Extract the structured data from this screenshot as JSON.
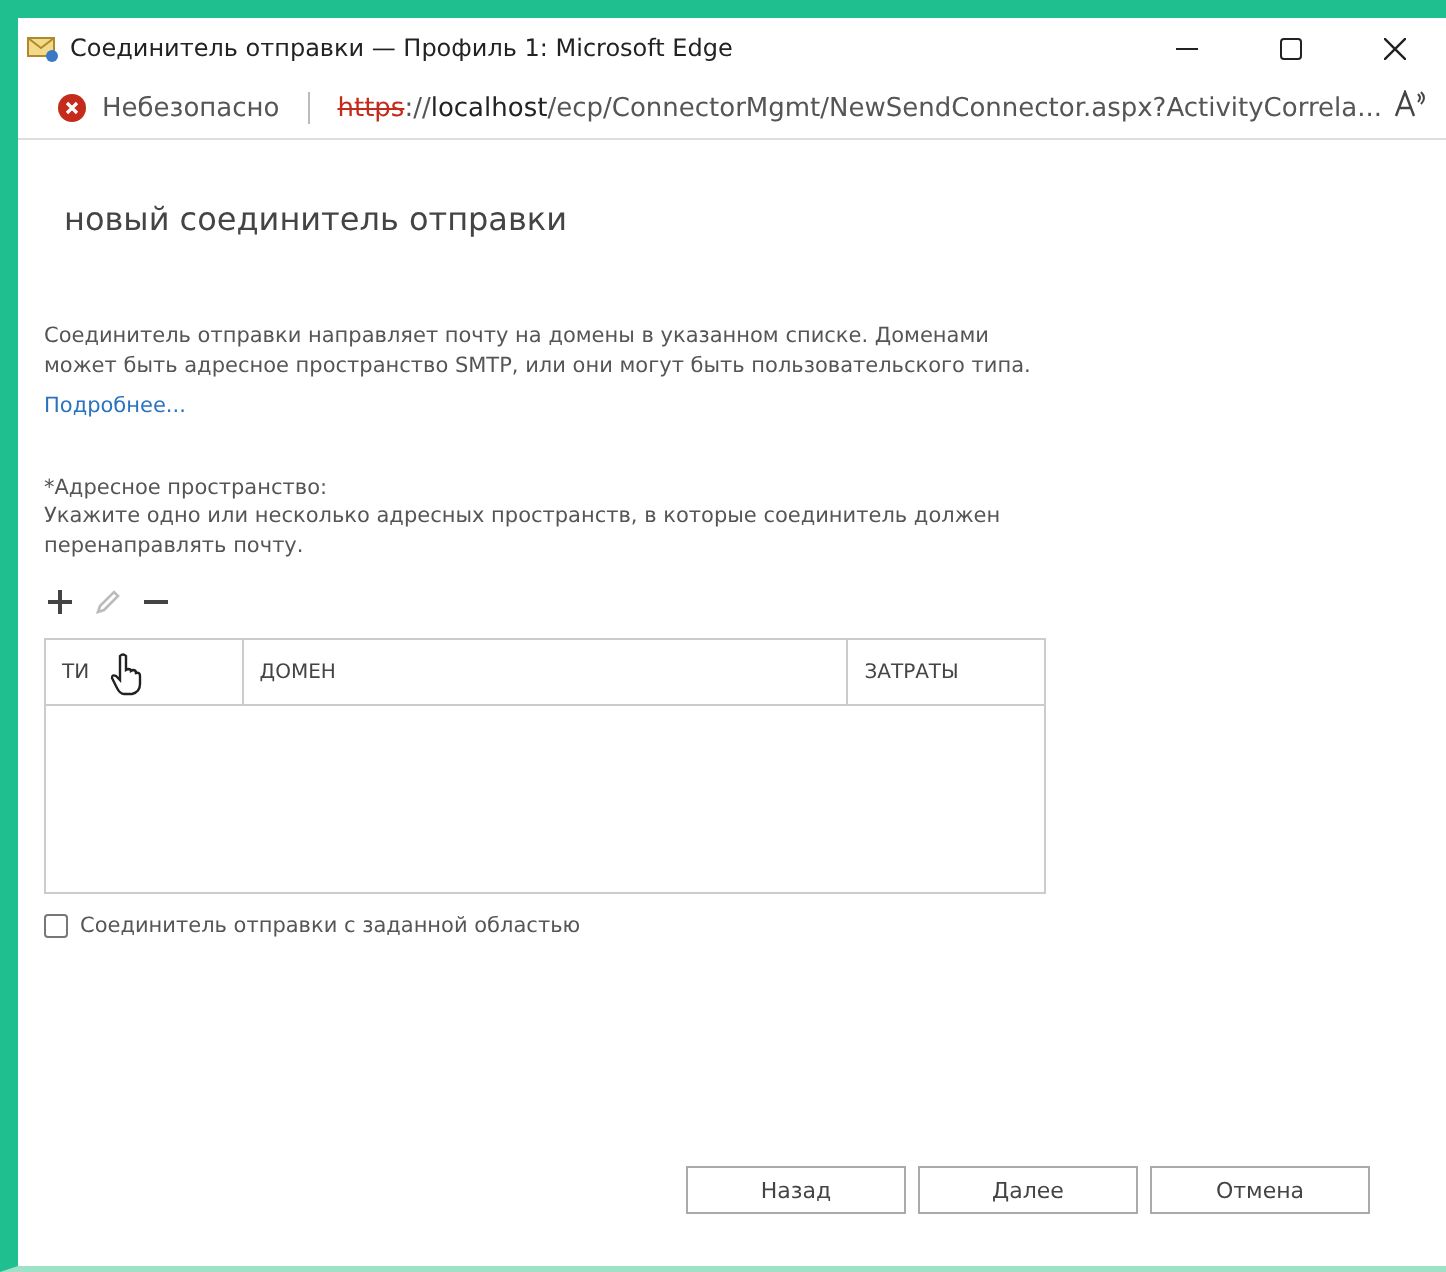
{
  "window": {
    "title": "Соединитель отправки — Профиль 1: Microsoft Edge"
  },
  "address_bar": {
    "security": "Небезопасно",
    "scheme": "https",
    "url_rest": "://",
    "host": "localhost",
    "path": "/ecp/ConnectorMgmt/NewSendConnector.aspx?ActivityCorrela..."
  },
  "page": {
    "heading": "новый соединитель отправки",
    "description": "Соединитель отправки направляет почту на домены в указанном списке. Доменами может быть адресное пространство SMTP, или они могут быть пользовательского типа.",
    "more_link": "Подробнее...",
    "address_space_label": "*Адресное пространство:",
    "address_space_hint": "Укажите одно или несколько адресных пространств, в которые соединитель должен перенаправлять почту.",
    "toolbar": [
      {
        "kind": "add",
        "disabled": false
      },
      {
        "kind": "edit",
        "disabled": true
      },
      {
        "kind": "remove",
        "disabled": false
      }
    ],
    "table": {
      "columns": [
        "ТИ",
        "ДОМЕН",
        "ЗАТРАТЫ"
      ]
    },
    "scoped": {
      "label": "Соединитель отправки с заданной областью",
      "checked": false
    },
    "buttons": [
      "Назад",
      "Далее",
      "Отмена"
    ]
  }
}
